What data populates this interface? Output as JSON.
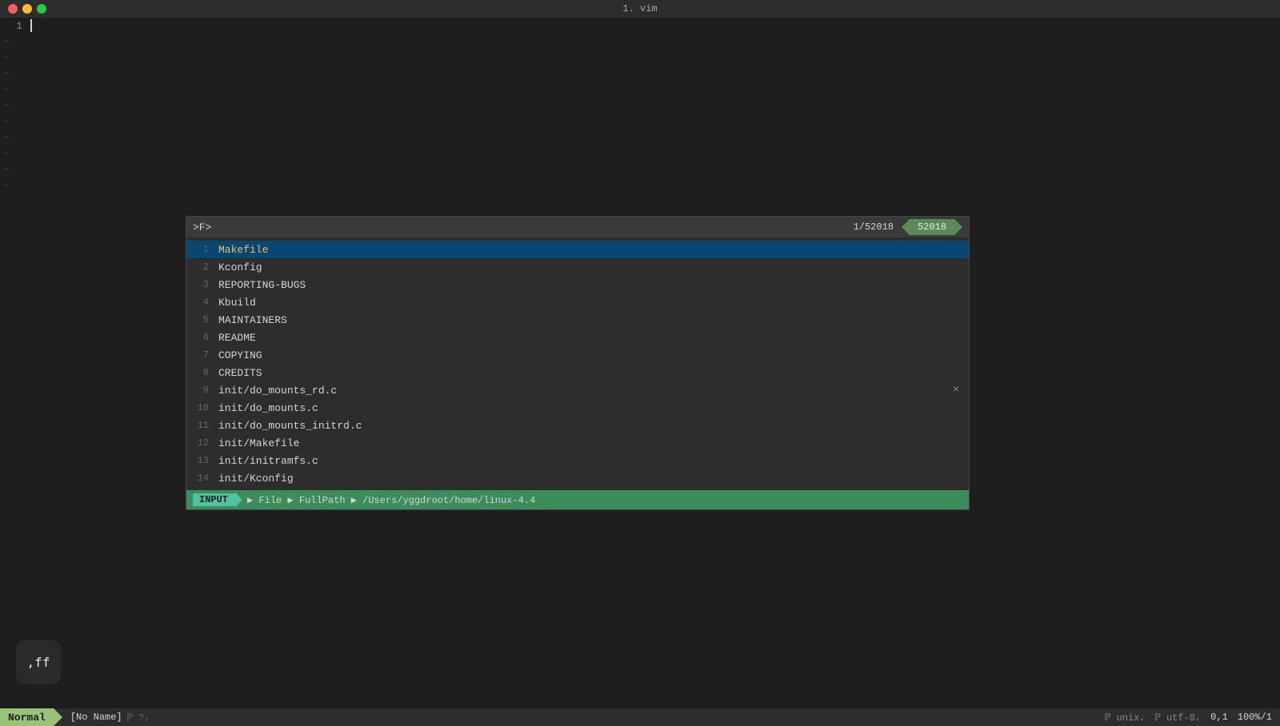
{
  "window": {
    "title": "1. vim"
  },
  "titlebar": {
    "title": "1. vim"
  },
  "editor": {
    "first_line_num": "1",
    "tilde_symbol": "~"
  },
  "fzf": {
    "prompt": ">F>",
    "counter_left": "1/52018",
    "counter_right": "52018",
    "items": [
      {
        "num": "1",
        "name": "Makefile",
        "highlight": true,
        "selected": true
      },
      {
        "num": "2",
        "name": "Kconfig",
        "highlight": false,
        "selected": false
      },
      {
        "num": "3",
        "name": "REPORTING-BUGS",
        "highlight": false,
        "selected": false
      },
      {
        "num": "4",
        "name": "Kbuild",
        "highlight": false,
        "selected": false
      },
      {
        "num": "5",
        "name": "MAINTAINERS",
        "highlight": false,
        "selected": false
      },
      {
        "num": "6",
        "name": "README",
        "highlight": false,
        "selected": false
      },
      {
        "num": "7",
        "name": "COPYING",
        "highlight": false,
        "selected": false
      },
      {
        "num": "8",
        "name": "CREDITS",
        "highlight": false,
        "selected": false
      },
      {
        "num": "9",
        "name": "init/do_mounts_rd.c",
        "highlight": false,
        "selected": false
      },
      {
        "num": "10",
        "name": "init/do_mounts.c",
        "highlight": false,
        "selected": false
      },
      {
        "num": "11",
        "name": "init/do_mounts_initrd.c",
        "highlight": false,
        "selected": false
      },
      {
        "num": "12",
        "name": "init/Makefile",
        "highlight": false,
        "selected": false
      },
      {
        "num": "13",
        "name": "init/initramfs.c",
        "highlight": false,
        "selected": false
      },
      {
        "num": "14",
        "name": "init/Kconfig",
        "highlight": false,
        "selected": false
      }
    ],
    "statusbar": {
      "mode": "INPUT",
      "breadcrumb1": "File",
      "breadcrumb2": "FullPath",
      "path": "/Users/yggdroot/home/linux-4.4"
    }
  },
  "statusbar": {
    "mode": "Normal",
    "filename": "[No Name]",
    "flags": "ℙ ?♩",
    "encoding_left": "ℙ unix♩",
    "encoding_right": "ℙ utf-8♩",
    "position": "0,1",
    "percent": "100%/1"
  },
  "ff_badge": {
    "line1": ",ff"
  }
}
